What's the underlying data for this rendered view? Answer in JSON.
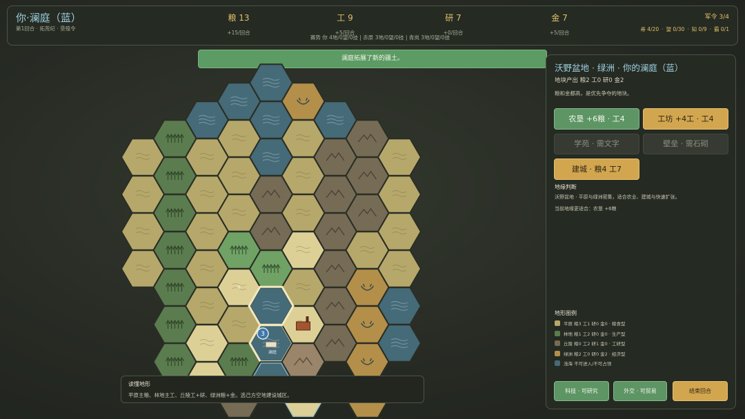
{
  "header": {
    "title": "你·澜庭（蓝）",
    "subtitle": "第1回合 · 拓荒纪 · 垦殖令",
    "resources": [
      {
        "label": "粮 13",
        "delta": "+15/回合"
      },
      {
        "label": "工 9",
        "delta": "+5/回合"
      },
      {
        "label": "研 7",
        "delta": "+0/回合"
      },
      {
        "label": "金 7",
        "delta": "+5/回合"
      }
    ],
    "trend": "赛势  你 4地/0望/0技  |  赤原 3地/0望/0技  |  青岚 3地/0望/0技",
    "army": "军令 3/4",
    "quotas": [
      "帚 4/20",
      "·",
      "望 0/30",
      "·",
      "知 0/9",
      "·",
      "霸 0/1"
    ]
  },
  "banner": "澜庭拓展了新的疆土。",
  "colors": {
    "plain": "#b6a86b",
    "forest": "#5b7c4f",
    "hill": "#766b55",
    "oasis": "#b38f4a",
    "water": "#456a78",
    "plain_light": "#ddd097",
    "forest_light": "#70a266",
    "hill_light": "#9a856b",
    "oasis_light": "#caa75e",
    "owned_border": "#e8dfb6",
    "selected_border": "#f2e9c0",
    "unit_badge": "#3f77a8"
  },
  "map": {
    "unit_count": "3",
    "unit_label": "澜庭",
    "small_marker": "8"
  },
  "hint": {
    "title": "读懂地形",
    "text": "平原主粮、林地主工、丘陵工+研、绿洲粮+金。选己方空地建设城区。"
  },
  "panel": {
    "title": "沃野盆地 · 绿洲 · 你的澜庭（蓝）",
    "yield": "地块产出  粮2  工0  研0  金2",
    "desc": "粮和金都高，是优先争夺的地块。",
    "buttons": {
      "farm": "农垦 +6粮 · 工4",
      "workshop": "工坊 +4工 · 工4",
      "academy": "学苑 · 需文字",
      "fort": "壁垒 · 需石砌",
      "city": "建城 · 粮4 工7"
    },
    "judge_title": "地缘判断",
    "judge_text": "沃野盆地 · 平原与绿洲密集，适合农业、建城与快速扩张。",
    "judge_best": "当前地缘更适合：农垦 +6粮",
    "legend_title": "地形图例",
    "legend": [
      {
        "label": "平原  粮3 工1 研0 金0 · 粮食型",
        "color": "#b6a86b"
      },
      {
        "label": "林地  粮1 工2 研0 金0 · 生产型",
        "color": "#5b7c4f"
      },
      {
        "label": "丘陵  粮0 工2 研1 金0 · 工研型",
        "color": "#766b55"
      },
      {
        "label": "绿洲  粮2 工0 研0 金2 · 经济型",
        "color": "#b38f4a"
      },
      {
        "label": "浅海  不可进入/不可占领",
        "color": "#456a78"
      }
    ],
    "bottom": {
      "tech": "科技 · 可研究",
      "diplomacy": "外交 · 可贸易",
      "end_turn": "结束回合"
    }
  }
}
